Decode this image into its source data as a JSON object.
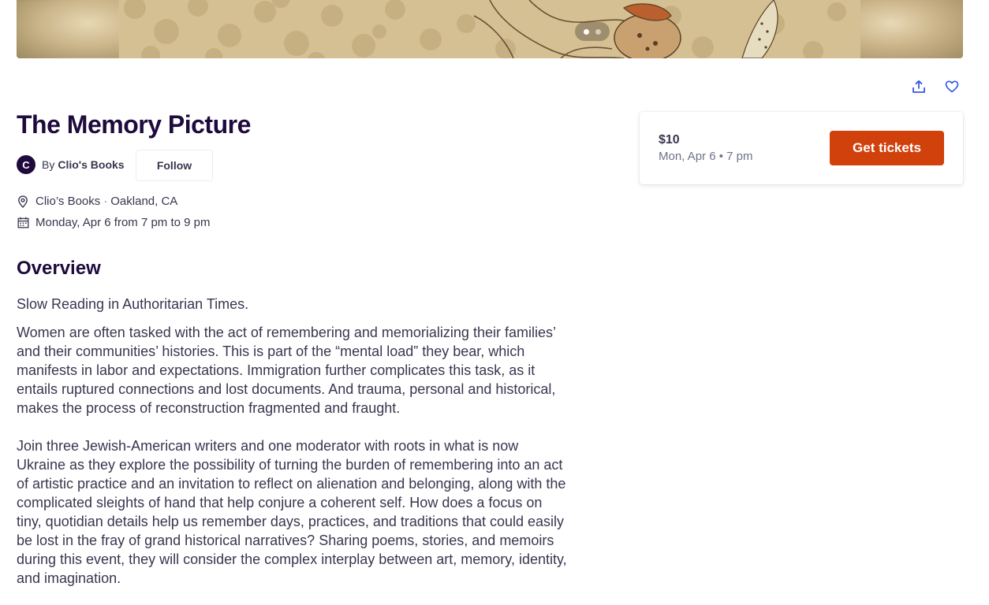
{
  "hero": {
    "slide_count": 2,
    "active_slide": 1
  },
  "actions": {
    "share_icon": "share-upload-icon",
    "like_icon": "heart-outline-icon"
  },
  "event": {
    "title": "The Memory Picture",
    "organizer": {
      "avatar_letter": "C",
      "by_label": "By",
      "name": "Clio's Books",
      "follow_label": "Follow"
    },
    "location": {
      "venue": "Clio’s Books",
      "separator": "·",
      "city": "Oakland, CA"
    },
    "date_time": "Monday, Apr 6 from 7 pm to 9 pm"
  },
  "overview": {
    "heading": "Overview",
    "summary": "Slow Reading in Authoritarian Times.",
    "paragraphs": [
      "Women are often tasked with the act of remembering and memorializing their families’ and their communities’ histories. This is part of the “mental load” they bear, which manifests in labor and expectations. Immigration further complicates this task, as it entails ruptured connections and lost documents. And trauma, personal and historical, makes the process of reconstruction fragmented and fraught.",
      "Join three Jewish-American writers and one moderator with roots in what is now Ukraine as they explore the possibility of turning the burden of remembering into an act of artistic practice and an invitation to reflect on alienation and belonging, along with the complicated sleights of hand that help conjure a coherent self. How does a focus on tiny, quotidian details help us remember days, practices, and traditions that could easily be lost in the fray of grand historical narratives? Sharing poems, stories, and memoirs during this event, they will consider the complex interplay between art, memory, identity, and imagination."
    ]
  },
  "ticket": {
    "price": "$10",
    "date": "Mon, Apr 6 • 7 pm",
    "cta_label": "Get tickets",
    "cta_color": "#d1410c"
  }
}
